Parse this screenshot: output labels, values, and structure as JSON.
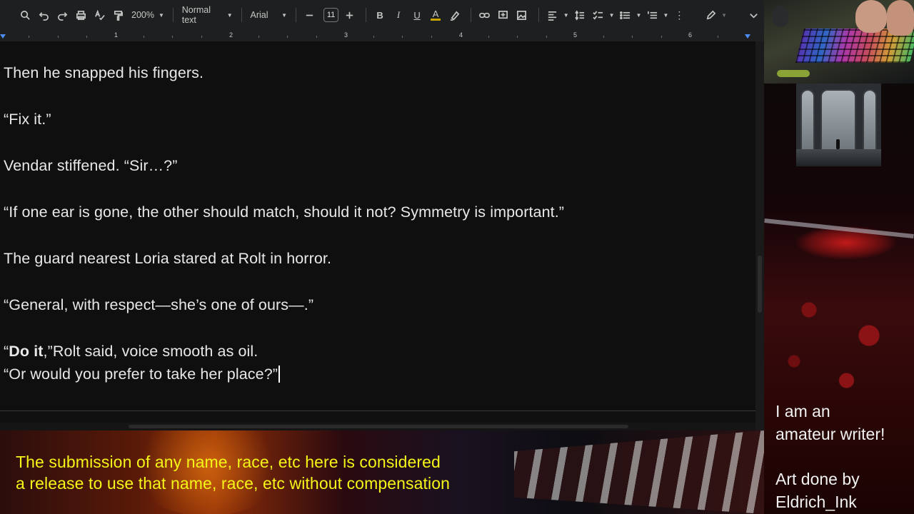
{
  "toolbar": {
    "zoom": "200%",
    "style": "Normal text",
    "font": "Arial",
    "font_size": "11",
    "bold": "B",
    "italic": "I",
    "underline": "U",
    "text_color": "A"
  },
  "ruler": {
    "numbers": [
      "1",
      "2",
      "3",
      "4",
      "5",
      "6"
    ]
  },
  "document": {
    "p1": "Then he snapped his fingers.",
    "p2": "“Fix it.”",
    "p3": "Vendar stiffened. “Sir…?”",
    "p4": "“If one ear is gone, the other should match, should it not? Symmetry is important.”",
    "p5": "The guard nearest Loria stared at Rolt in horror.",
    "p6": "“General, with respect—she’s one of ours—.”",
    "p7_open": "“",
    "p7_bold": "Do it",
    "p7_rest": ",”Rolt said, voice smooth as oil.",
    "p8": "“Or would you prefer to take her place?”"
  },
  "side": {
    "line1": "I am an",
    "line2": "amateur writer!",
    "line3": "Art done by",
    "line4": "Eldrich_Ink"
  },
  "banner": {
    "line1": "The submission of any name, race, etc here is considered",
    "line2": "a release to use that name, race, etc without compensation"
  },
  "colors": {
    "notice_yellow": "#f5f518",
    "doc_bg": "#0f0f10",
    "toolbar_bg": "#1e1f20",
    "ruler_marker": "#4c8df6"
  }
}
